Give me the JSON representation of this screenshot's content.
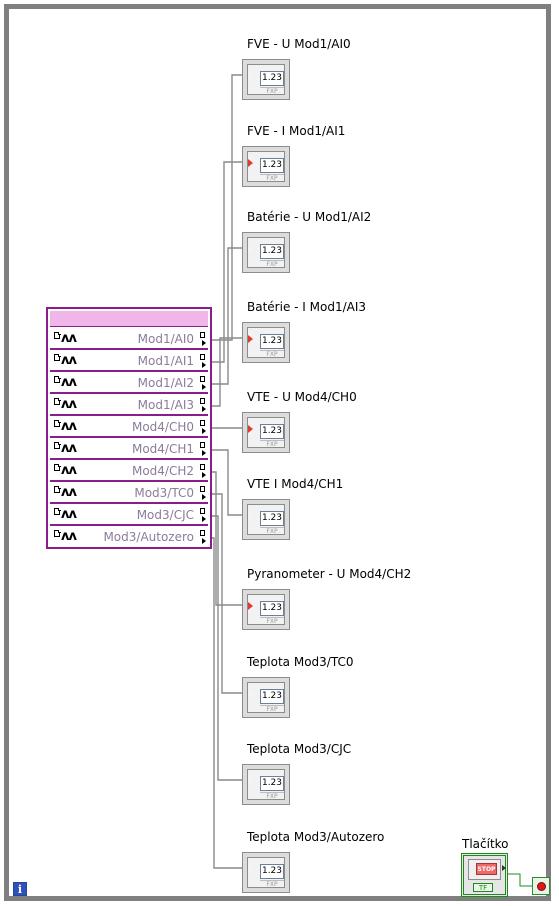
{
  "indicators": [
    {
      "label": "FVE - U Mod1/AI0",
      "value": "1.23",
      "type": "FXP",
      "coerced": false
    },
    {
      "label": "FVE - I Mod1/AI1",
      "value": "1.23",
      "type": "FXP",
      "coerced": true
    },
    {
      "label": "Batérie - U Mod1/AI2",
      "value": "1.23",
      "type": "FXP",
      "coerced": false
    },
    {
      "label": "Batérie - I Mod1/AI3",
      "value": "1.23",
      "type": "FXP",
      "coerced": true
    },
    {
      "label": "VTE - U Mod4/CH0",
      "value": "1.23",
      "type": "FXP",
      "coerced": true
    },
    {
      "label": "VTE I Mod4/CH1",
      "value": "1.23",
      "type": "FXP",
      "coerced": false
    },
    {
      "label": "Pyranometer - U Mod4/CH2",
      "value": "1.23",
      "type": "FXP",
      "coerced": true
    },
    {
      "label": "Teplota Mod3/TC0",
      "value": "1.23",
      "type": "FXP",
      "coerced": false
    },
    {
      "label": "Teplota Mod3/CJC",
      "value": "1.23",
      "type": "FXP",
      "coerced": false
    },
    {
      "label": "Teplota Mod3/Autozero",
      "value": "1.23",
      "type": "FXP",
      "coerced": false
    }
  ],
  "property_node": {
    "wave_glyph": "ʌʌ",
    "items": [
      "Mod1/AI0",
      "Mod1/AI1",
      "Mod1/AI2",
      "Mod1/AI3",
      "Mod4/CH0",
      "Mod4/CH1",
      "Mod4/CH2",
      "Mod3/TC0",
      "Mod3/CJC",
      "Mod3/Autozero"
    ]
  },
  "stop": {
    "label": "Tlačítko",
    "button_text": "STOP",
    "type": "TF"
  },
  "loop_iteration_glyph": "i",
  "colors": {
    "frame": "#7f7f7f",
    "property_node": "#8a1d8a",
    "header": "#f0b6ea",
    "wire": "#8a8a8a",
    "boolean": "#1e8a1e",
    "stop_red": "#e01818"
  }
}
